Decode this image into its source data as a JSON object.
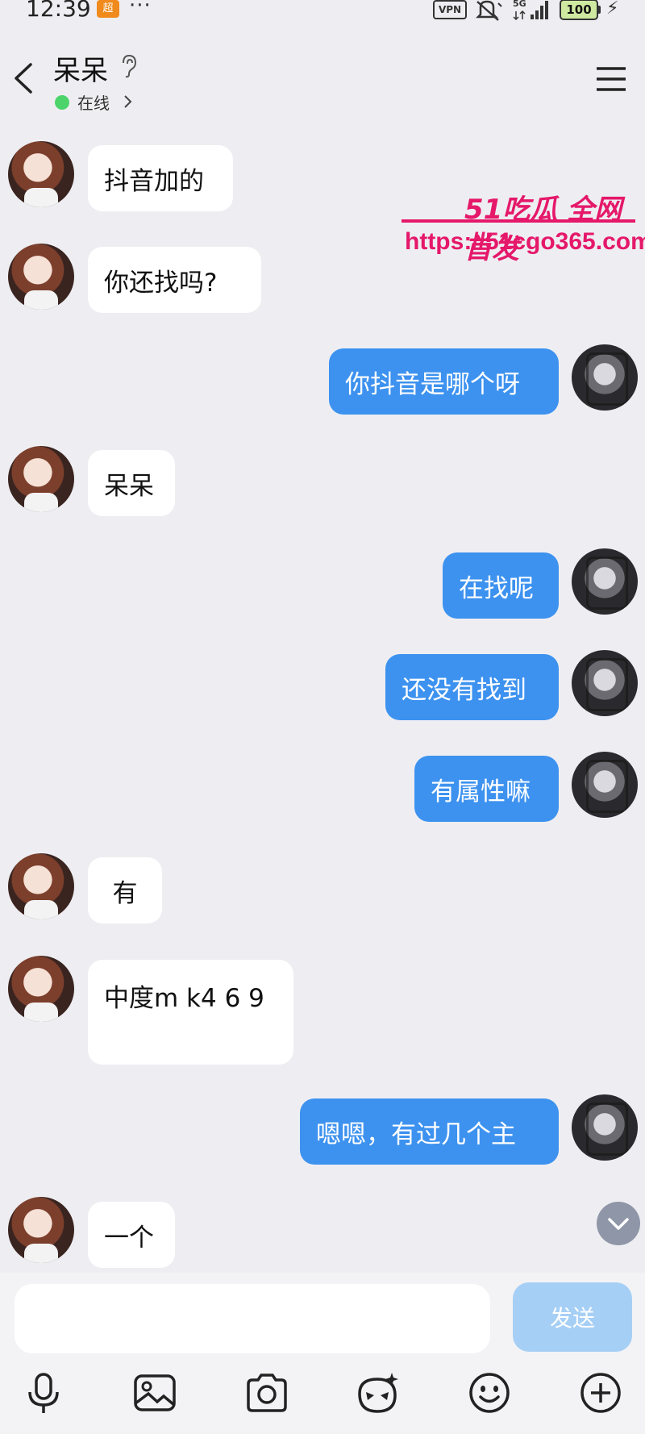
{
  "status_bar": {
    "time": "12:39",
    "app_badge": "超",
    "more": "···",
    "vpn": "VPN",
    "network": "5G",
    "battery": "100"
  },
  "header": {
    "contact_name": "呆呆",
    "status": "在线"
  },
  "watermark": {
    "title": "51吃瓜 全网首发",
    "url": "https://51cgo365.com"
  },
  "messages": [
    {
      "side": "left",
      "text": "抖音加的"
    },
    {
      "side": "left",
      "text": "你还找吗?"
    },
    {
      "side": "right",
      "text": "你抖音是哪个呀"
    },
    {
      "side": "left",
      "text": "呆呆"
    },
    {
      "side": "right",
      "text": "在找呢"
    },
    {
      "side": "right",
      "text": "还没有找到"
    },
    {
      "side": "right",
      "text": "有属性嘛"
    },
    {
      "side": "left",
      "text": "有"
    },
    {
      "side": "left",
      "text": "中度m k4 6 9"
    },
    {
      "side": "right",
      "text": "嗯嗯，有过几个主"
    },
    {
      "side": "left",
      "text": "一个"
    }
  ],
  "composer": {
    "placeholder": "",
    "send_label": "发送"
  },
  "toolbar_icons": [
    "microphone-icon",
    "image-icon",
    "camera-icon",
    "sticker-icon",
    "emoji-icon",
    "plus-icon"
  ],
  "colors": {
    "background": "#eeeef2",
    "outgoing_bubble": "#3d92ef",
    "incoming_bubble": "#ffffff",
    "send_button": "#a6cff6",
    "online": "#4cd46a",
    "watermark": "#e5186a"
  }
}
